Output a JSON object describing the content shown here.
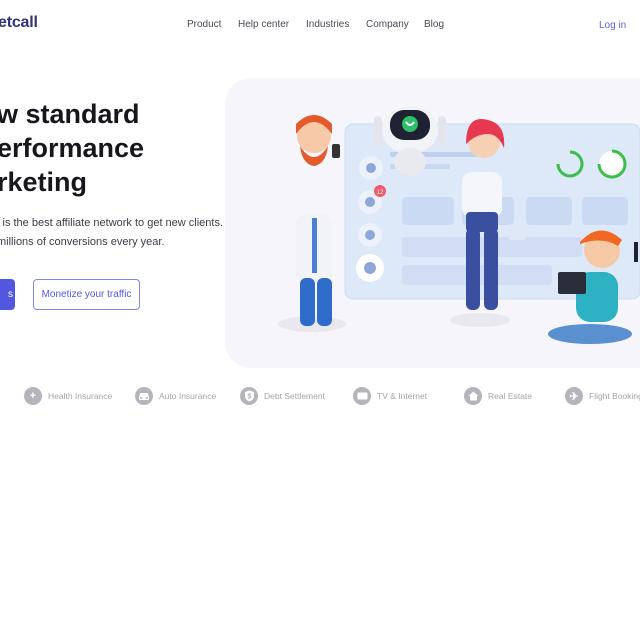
{
  "nav": {
    "logo": "etcall",
    "links": [
      "Product",
      "Help center",
      "Industries",
      "Company",
      "Blog"
    ],
    "login": "Log in"
  },
  "hero": {
    "headline": [
      "w standard",
      "erformance",
      "rketing"
    ],
    "subtext": [
      "l is the best affiliate network to get new clients.",
      "millions of conversions every year."
    ],
    "primary_button": "s",
    "secondary_button": "Monetize your traffic",
    "card_badge": "12"
  },
  "categories": [
    {
      "label": "Health Insurance",
      "icon": "plus-icon"
    },
    {
      "label": "Auto Insurance",
      "icon": "car-icon"
    },
    {
      "label": "Debt Settlement",
      "icon": "shield-dollar-icon"
    },
    {
      "label": "TV & Internet",
      "icon": "tv-icon"
    },
    {
      "label": "Real Estate",
      "icon": "house-icon"
    },
    {
      "label": "Flight Booking",
      "icon": "airplane-icon"
    }
  ],
  "colors": {
    "brand": "#33337a",
    "accent": "#5257e0",
    "muted": "#a4a4ac",
    "hero_bg": "#f6f5fb"
  }
}
